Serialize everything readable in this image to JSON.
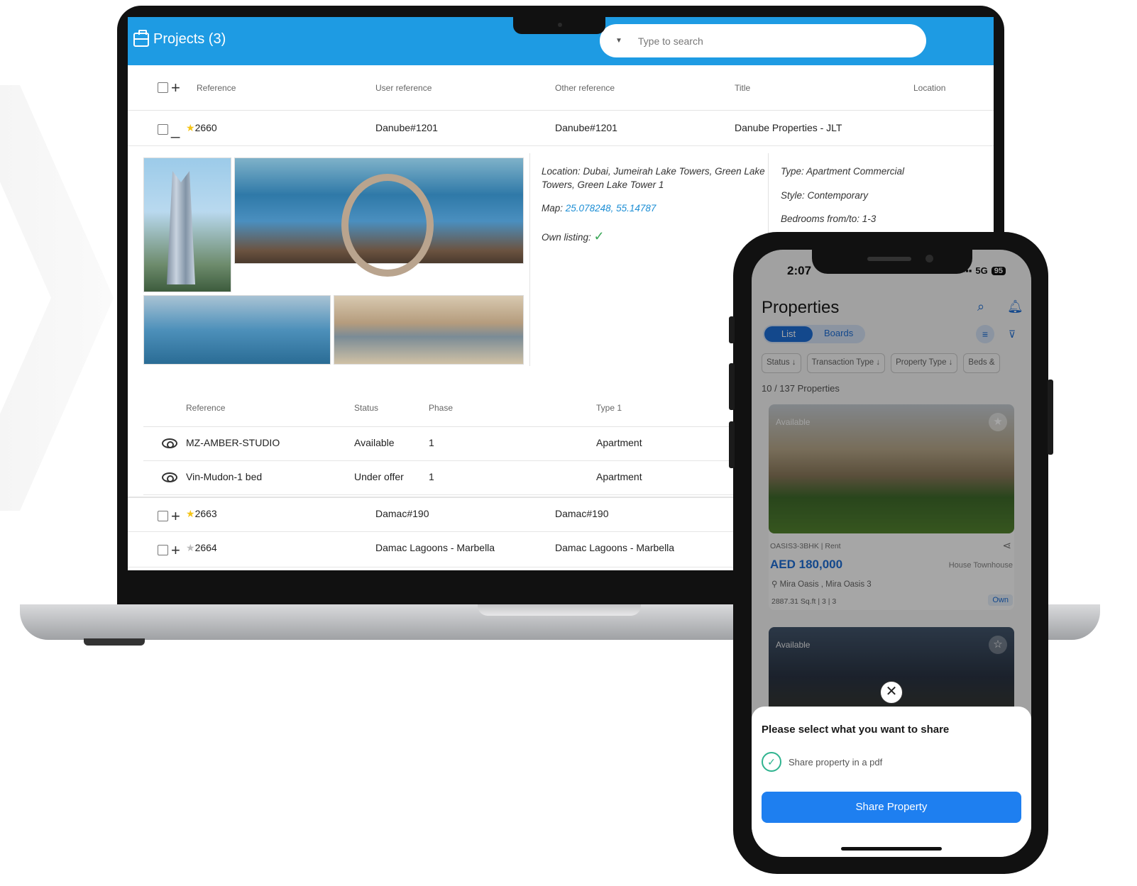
{
  "laptop": {
    "app_title": "Projects (3)",
    "search_placeholder": "Type to search",
    "columns": [
      "Reference",
      "User reference",
      "Other reference",
      "Title",
      "Location"
    ],
    "rows": [
      {
        "ref": "2660",
        "user_ref": "Danube#1201",
        "other_ref": "Danube#1201",
        "title": "Danube Properties - JLT",
        "expanded": true,
        "starred": true
      },
      {
        "ref": "2663",
        "user_ref": "Damac#190",
        "other_ref": "Damac#190",
        "starred": true
      },
      {
        "ref": "2664",
        "user_ref": "Damac Lagoons - Marbella",
        "other_ref": "Damac Lagoons - Marbella",
        "starred": false
      }
    ],
    "detail": {
      "location": "Location: Dubai, Jumeirah Lake Towers, Green Lake Towers, Green Lake Tower 1",
      "map_label": "Map:",
      "map_value": "25.078248, 55.14787",
      "own_listing": "Own listing:",
      "type": "Type: Apartment Commercial",
      "style": "Style: Contemporary",
      "bedrooms": "Bedrooms from/to: 1-3"
    },
    "sub_columns": [
      "Reference",
      "Status",
      "Phase",
      "Type 1"
    ],
    "sub_rows": [
      {
        "ref": "MZ-AMBER-STUDIO",
        "status": "Available",
        "phase": "1",
        "type": "Apartment"
      },
      {
        "ref": "Vin-Mudon-1 bed",
        "status": "Under offer",
        "phase": "1",
        "type": "Apartment"
      }
    ]
  },
  "phone": {
    "time": "2:07",
    "network": "5G",
    "battery": "95",
    "title": "Properties",
    "tabs": [
      "List",
      "Boards"
    ],
    "filters": [
      "Status ↓",
      "Transaction Type ↓",
      "Property Type ↓",
      "Beds &"
    ],
    "count": "10 / 137 Properties",
    "card": {
      "badge": "Available",
      "ref": "OASIS3-3BHK | Rent",
      "price": "AED 180,000",
      "type": "House  Townhouse",
      "location": "Mira Oasis , Mira Oasis 3",
      "specs": "2887.31 Sq.ft  |  3  |  3",
      "own": "Own"
    },
    "card2_badge": "Available",
    "sheet": {
      "title": "Please select what you want to share",
      "option": "Share property in a pdf",
      "button": "Share Property"
    }
  }
}
